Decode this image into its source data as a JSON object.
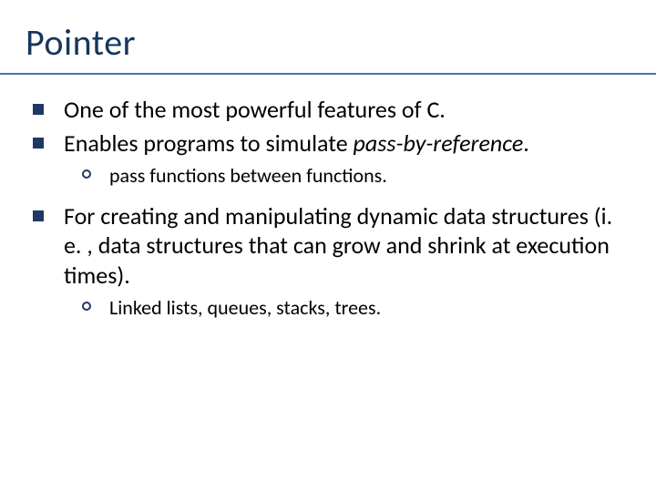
{
  "title": "Pointer",
  "bullets": [
    {
      "text": "One of the most powerful features of C.",
      "sub": []
    },
    {
      "text_pre": "Enables programs to simulate ",
      "text_em": "pass-by-reference",
      "text_post": ".",
      "sub": [
        {
          "text": "pass functions between functions."
        }
      ]
    },
    {
      "text": "For creating and manipulating dynamic data structures (i. e. , data structures that can grow and shrink at execution times).",
      "sub": [
        {
          "text": "Linked lists, queues, stacks, trees."
        }
      ]
    }
  ]
}
